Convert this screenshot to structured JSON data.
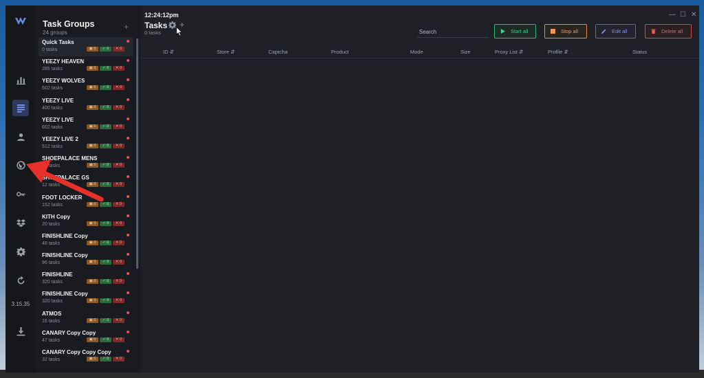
{
  "app": {
    "version": "3.15.35"
  },
  "sidebar": {
    "items": [
      {
        "name": "analytics",
        "icon": "bar-chart-icon"
      },
      {
        "name": "tasks",
        "icon": "task-list-icon",
        "active": true
      },
      {
        "name": "profiles",
        "icon": "user-icon"
      },
      {
        "name": "proxies",
        "icon": "globe-icon"
      },
      {
        "name": "accounts",
        "icon": "key-icon"
      },
      {
        "name": "harvester",
        "icon": "dropbox-icon"
      },
      {
        "name": "settings",
        "icon": "gear-icon"
      },
      {
        "name": "refresh",
        "icon": "refresh-icon"
      },
      {
        "name": "download",
        "icon": "download-icon"
      }
    ]
  },
  "task_groups": {
    "title": "Task Groups",
    "count": "24 groups",
    "add": "+",
    "groups": [
      {
        "name": "Quick Tasks",
        "tasks": "0 tasks",
        "b1": "0",
        "b2": "0",
        "b3": "0"
      },
      {
        "name": "YEEZY HEAVEN",
        "tasks": "285 tasks",
        "b1": "0",
        "b2": "0",
        "b3": "0"
      },
      {
        "name": "YEEZY WOLVES",
        "tasks": "602 tasks",
        "b1": "0",
        "b2": "0",
        "b3": "0"
      },
      {
        "name": "YEEZY LIVE",
        "tasks": "400 tasks",
        "b1": "0",
        "b2": "0",
        "b3": "0"
      },
      {
        "name": "YEEZY LIVE",
        "tasks": "602 tasks",
        "b1": "0",
        "b2": "0",
        "b3": "0"
      },
      {
        "name": "YEEZY LIVE 2",
        "tasks": "512 tasks",
        "b1": "0",
        "b2": "0",
        "b3": "0"
      },
      {
        "name": "SHOEPALACE MENS",
        "tasks": "12 tasks",
        "b1": "0",
        "b2": "0",
        "b3": "0"
      },
      {
        "name": "SHOEPALACE GS",
        "tasks": "12 tasks",
        "b1": "0",
        "b2": "0",
        "b3": "0"
      },
      {
        "name": "FOOT LOCKER",
        "tasks": "152 tasks",
        "b1": "0",
        "b2": "0",
        "b3": "0"
      },
      {
        "name": "KITH Copy",
        "tasks": "20 tasks",
        "b1": "0",
        "b2": "0",
        "b3": "0"
      },
      {
        "name": "FINISHLINE Copy",
        "tasks": "48 tasks",
        "b1": "0",
        "b2": "0",
        "b3": "0"
      },
      {
        "name": "FINISHLINE Copy",
        "tasks": "96 tasks",
        "b1": "0",
        "b2": "0",
        "b3": "0"
      },
      {
        "name": "FINISHLINE",
        "tasks": "320 tasks",
        "b1": "0",
        "b2": "0",
        "b3": "0"
      },
      {
        "name": "FINISHLINE Copy",
        "tasks": "320 tasks",
        "b1": "0",
        "b2": "0",
        "b3": "0"
      },
      {
        "name": "ATMOS",
        "tasks": "16 tasks",
        "b1": "0",
        "b2": "0",
        "b3": "0"
      },
      {
        "name": "CANARY Copy Copy",
        "tasks": "47 tasks",
        "b1": "0",
        "b2": "0",
        "b3": "0"
      },
      {
        "name": "CANARY Copy Copy Copy",
        "tasks": "32 tasks",
        "b1": "0",
        "b2": "0",
        "b3": "0"
      }
    ]
  },
  "main": {
    "clock": "12:24:12pm",
    "title": "Tasks",
    "count": "0 tasks",
    "add": "+",
    "search_placeholder": "Search",
    "buttons": {
      "start": "Start all",
      "stop": "Stop all",
      "edit": "Edit all",
      "delete": "Delete all"
    },
    "columns": [
      {
        "label": "ID",
        "sortable": true
      },
      {
        "label": "Store",
        "sortable": true
      },
      {
        "label": "Captcha",
        "sortable": false
      },
      {
        "label": "Product",
        "sortable": false
      },
      {
        "label": "Mode",
        "sortable": false
      },
      {
        "label": "Size",
        "sortable": false
      },
      {
        "label": "Proxy List",
        "sortable": true
      },
      {
        "label": "Profile",
        "sortable": true
      },
      {
        "label": "Status",
        "sortable": false
      }
    ],
    "window_controls": {
      "minimize": "—",
      "maximize": "☐",
      "close": "✕"
    }
  },
  "colors": {
    "accent": "#7a9cff",
    "start": "#3fd08d",
    "stop": "#f09a5c",
    "edit": "#8a8ff0",
    "delete": "#ec5e5e",
    "annotation_arrow": "#e8302a"
  }
}
